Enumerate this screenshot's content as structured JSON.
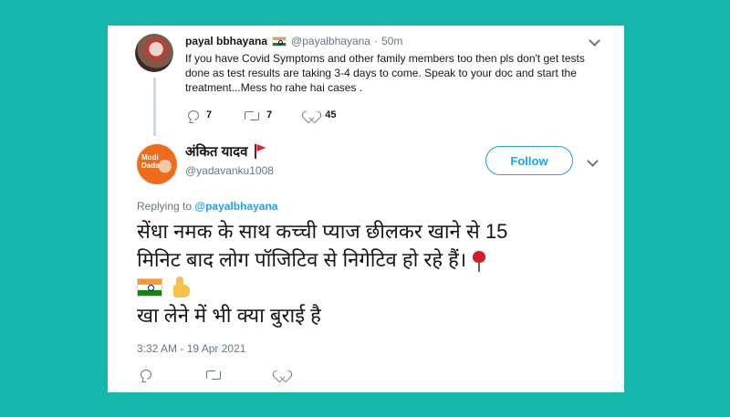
{
  "parent_tweet": {
    "display_name": "payal bbhayana",
    "handle": "@payalbhayana",
    "time": "50m",
    "text": "If you have Covid Symptoms and other family members too then pls don't get tests done as test results are taking 3-4 days to come. Speak to your doc and start the treatment...Mess ho rahe hai cases .",
    "replies": "7",
    "retweets": "7",
    "likes": "45"
  },
  "main_tweet": {
    "display_name": "अंकित यादव",
    "handle": "@yadavanku1008",
    "avatar_text": "Modi Dada",
    "follow_label": "Follow",
    "replying_prefix": "Replying to",
    "replying_to": "@payalbhayana",
    "text_line1": "सेंधा नमक के साथ कच्ची प्याज छीलकर खाने से 15",
    "text_line2": "मिनिट बाद लोग पॉजिटिव से निगेटिव हो रहे हैं।",
    "text_line4": "खा लेने में भी क्या बुराई है",
    "timestamp": "3:32 AM - 19 Apr 2021"
  },
  "icons": [
    "reply-icon",
    "retweet-icon",
    "like-icon",
    "chevron-down-icon",
    "india-flag-icon",
    "red-flag-icon",
    "rose-icon",
    "thumbs-up-icon"
  ],
  "colors": {
    "background": "#17b6ad",
    "accent": "#1da1f2",
    "secondary_text": "#657786"
  }
}
